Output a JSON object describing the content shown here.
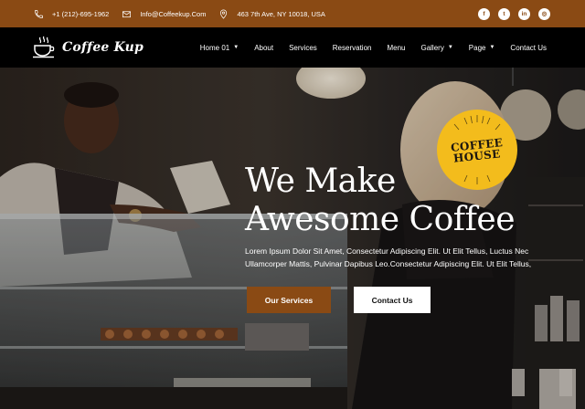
{
  "topbar": {
    "phone": "+1 (212)-695-1962",
    "email": "Info@Coffeekup.Com",
    "address": "463 7th Ave, NY 10018, USA",
    "socials": [
      {
        "icon": "facebook-icon",
        "glyph": "f"
      },
      {
        "icon": "twitter-icon",
        "glyph": "t"
      },
      {
        "icon": "linkedin-icon",
        "glyph": "in"
      },
      {
        "icon": "instagram-icon",
        "glyph": "◎"
      }
    ]
  },
  "brand": {
    "name": "Coffee Kup"
  },
  "nav": {
    "items": [
      {
        "label": "Home 01",
        "dropdown": true
      },
      {
        "label": "About",
        "dropdown": false
      },
      {
        "label": "Services",
        "dropdown": false
      },
      {
        "label": "Reservation",
        "dropdown": false
      },
      {
        "label": "Menu",
        "dropdown": false
      },
      {
        "label": "Gallery",
        "dropdown": true
      },
      {
        "label": "Page",
        "dropdown": true
      },
      {
        "label": "Contact Us",
        "dropdown": false
      }
    ]
  },
  "hero": {
    "badge_line1": "COFFEE",
    "badge_line2": "HOUSE",
    "headline_line1": "We Make",
    "headline_line2": "Awesome Coffee",
    "subtext": "Lorem Ipsum Dolor Sit Amet, Consectetur Adipiscing Elit. Ut Elit Tellus, Luctus Nec Ullamcorper Mattis, Pulvinar Dapibus Leo.Consectetur Adipiscing Elit. Ut Elit Tellus,",
    "primary_button": "Our Services",
    "secondary_button": "Contact Us"
  },
  "colors": {
    "accent": "#8a4a14",
    "badge": "#f3bc1c",
    "nav_bg": "#000000"
  }
}
